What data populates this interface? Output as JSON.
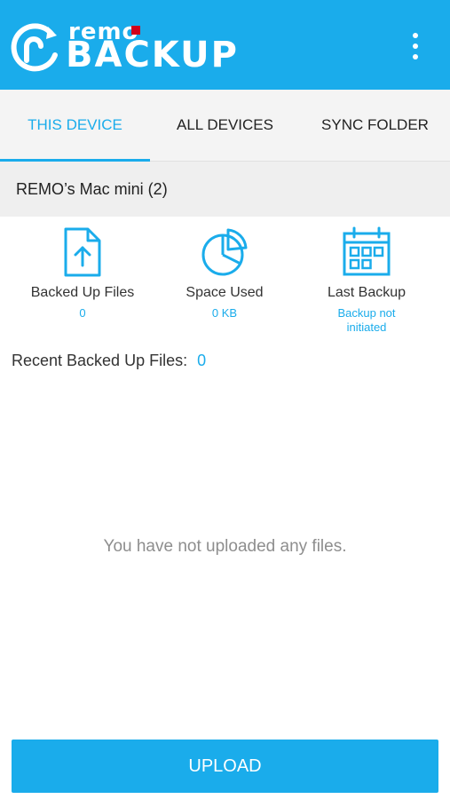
{
  "header": {
    "logo_small": "remo",
    "logo_large": "BACKUP",
    "menu_icon": "more-vertical-icon",
    "color": "#1AACEB"
  },
  "tabs": [
    {
      "label": "THIS DEVICE",
      "active": true
    },
    {
      "label": "ALL DEVICES",
      "active": false
    },
    {
      "label": "SYNC FOLDER",
      "active": false
    }
  ],
  "device": {
    "name": "REMO’s Mac mini (2)"
  },
  "stats": {
    "backed_up_files": {
      "label": "Backed Up Files",
      "value": "0",
      "icon": "file-upload-icon"
    },
    "space_used": {
      "label": "Space Used",
      "value": "0 KB",
      "icon": "pie-chart-icon"
    },
    "last_backup": {
      "label": "Last Backup",
      "value_line1": "Backup not",
      "value_line2": "initiated",
      "icon": "calendar-icon"
    }
  },
  "recent": {
    "label": "Recent Backed Up Files:",
    "count": "0"
  },
  "empty_message": "You have not uploaded any files.",
  "upload_button": {
    "label": "UPLOAD"
  },
  "accent_color": "#1AACEB",
  "logo_dot_color": "#D0021B"
}
